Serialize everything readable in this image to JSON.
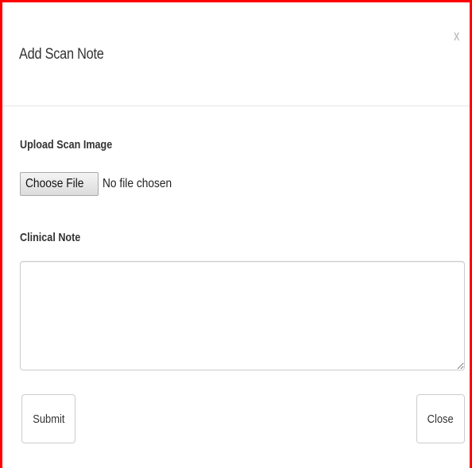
{
  "modal": {
    "title": "Add Scan Note",
    "close_glyph": "x",
    "frame_color": "#ff0000"
  },
  "upload": {
    "label": "Upload Scan Image",
    "button_label": "Choose File",
    "status": "No file chosen"
  },
  "note": {
    "label": "Clinical Note",
    "value": "",
    "placeholder": ""
  },
  "footer": {
    "submit_label": "Submit",
    "close_label": "Close"
  }
}
